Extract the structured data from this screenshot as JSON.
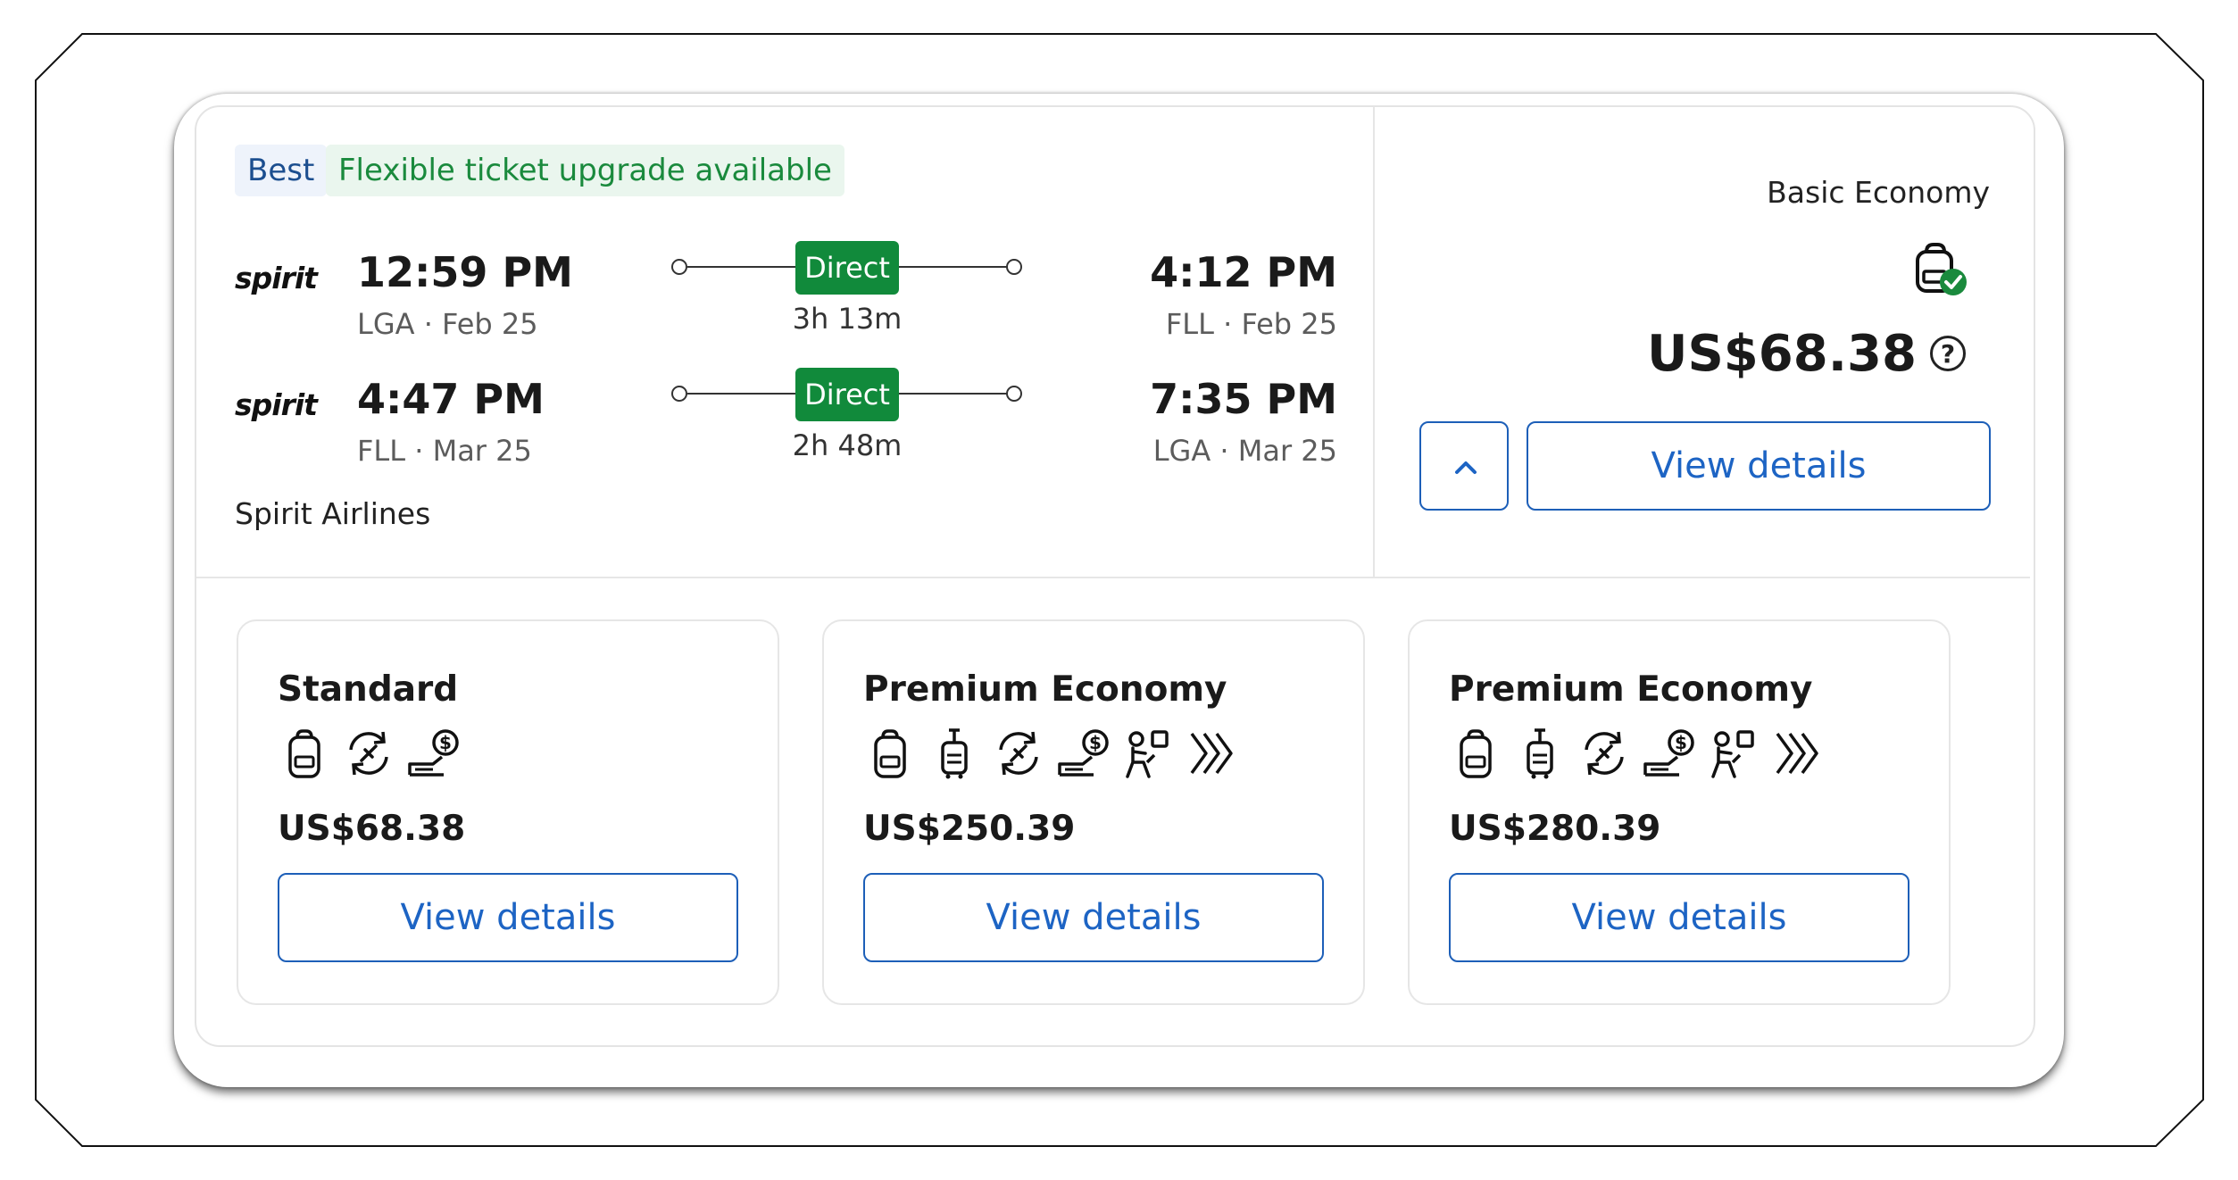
{
  "badges": {
    "best": "Best",
    "flex": "Flexible ticket upgrade available"
  },
  "outbound": {
    "logo": "spirit",
    "depart_time": "12:59 PM",
    "depart_info": "LGA · Feb 25",
    "stops": "Direct",
    "duration": "3h 13m",
    "arrive_time": "4:12 PM",
    "arrive_info": "FLL · Feb 25"
  },
  "return": {
    "logo": "spirit",
    "depart_time": "4:47 PM",
    "depart_info": "FLL · Mar 25",
    "stops": "Direct",
    "duration": "2h 48m",
    "arrive_time": "7:35 PM",
    "arrive_info": "LGA · Mar 25"
  },
  "airline_name": "Spirit Airlines",
  "selected": {
    "fare_class": "Basic Economy",
    "price": "US$68.38",
    "help_glyph": "?",
    "view_label": "View details"
  },
  "options": [
    {
      "title": "Standard",
      "price": "US$68.38",
      "view_label": "View details",
      "icons": [
        "personal-item-icon",
        "change-flight-icon",
        "paid-seat-icon"
      ]
    },
    {
      "title": "Premium Economy",
      "price": "US$250.39",
      "view_label": "View details",
      "icons": [
        "personal-item-icon",
        "carry-on-icon",
        "change-flight-icon",
        "paid-seat-icon",
        "seat-choice-icon",
        "priority-icon"
      ]
    },
    {
      "title": "Premium Economy",
      "price": "US$280.39",
      "view_label": "View details",
      "icons": [
        "personal-item-icon",
        "carry-on-icon",
        "change-flight-icon",
        "paid-seat-icon",
        "seat-choice-icon",
        "priority-icon"
      ]
    }
  ],
  "colors": {
    "accent": "#1d64c4",
    "direct": "#118a3b",
    "best_text": "#1b4e8f",
    "flex_text": "#1a8a3d"
  }
}
